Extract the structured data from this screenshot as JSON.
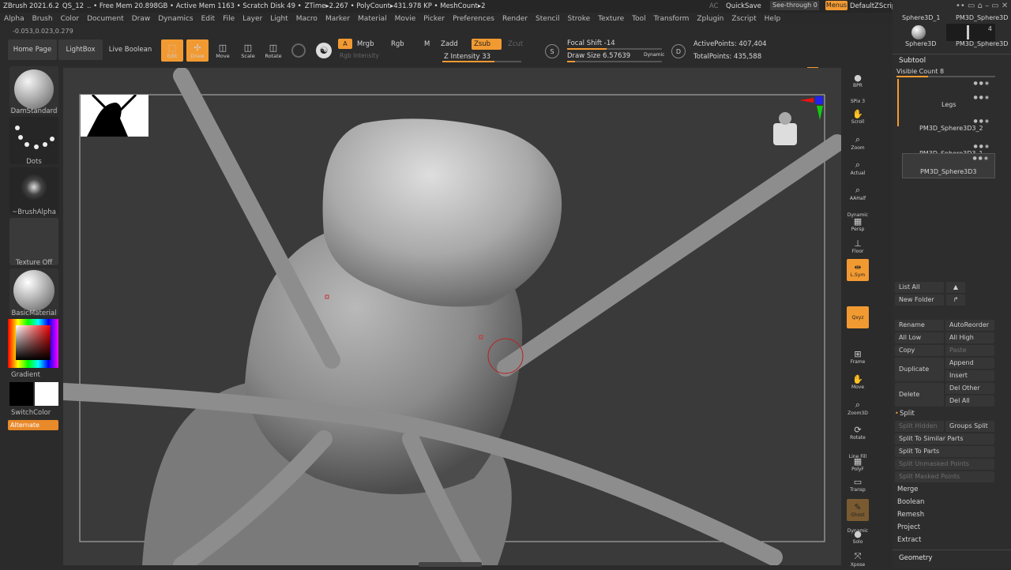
{
  "titlebar": {
    "items": [
      "ZBrush 2021.6.2",
      "QS_12",
      ".. • Free Mem 20.898GB • Active Mem 1163 • Scratch Disk 49 •",
      "ZTime▸2.267 • PolyCount▸431.978 KP • MeshCount▸2"
    ],
    "ac": "AC",
    "quicksave": "QuickSave",
    "seethrough": "See-through  0",
    "menus": "Menus",
    "script": "DefaultZScript"
  },
  "menubar": [
    "Alpha",
    "Brush",
    "Color",
    "Document",
    "Draw",
    "Dynamics",
    "Edit",
    "File",
    "Layer",
    "Light",
    "Macro",
    "Marker",
    "Material",
    "Movie",
    "Picker",
    "Preferences",
    "Render",
    "Stencil",
    "Stroke",
    "Texture",
    "Tool",
    "Transform",
    "Zplugin",
    "Zscript",
    "Help"
  ],
  "coords": "-0.053,0.023,0.279",
  "toolbar": {
    "home": "Home Page",
    "lightbox": "LightBox",
    "live_boolean": "Live Boolean",
    "edit": "Edit",
    "draw": "Draw",
    "move": "Move",
    "scale": "Scale",
    "rotate": "Rotate",
    "a": "A",
    "mrgb": "Mrgb",
    "rgb": "Rgb",
    "m": "M",
    "zadd": "Zadd",
    "zsub": "Zsub",
    "zcut": "Zcut",
    "rgb_intensity": "Rgb Intensity",
    "z_intensity": "Z Intensity 33",
    "focal_shift": "Focal Shift -14",
    "draw_size": "Draw Size 6.57639",
    "dynamic": "Dynamic",
    "active_points": "ActivePoints: 407,404",
    "total_points": "TotalPoints: 435,588",
    "s": "S",
    "d": "D"
  },
  "left": {
    "brush": "DamStandard",
    "stroke": "Dots",
    "alpha": "~BrushAlpha",
    "texture": "Texture Off",
    "material": "BasicMaterial",
    "gradient": "Gradient",
    "switchcolor": "SwitchColor",
    "alternate": "Alternate"
  },
  "rail": [
    "BPR",
    "SPix 3",
    "Scroll",
    "Zoom",
    "Actual",
    "AAHalf",
    "Dynamic",
    "Persp",
    "Floor",
    "L.Sym",
    "Qxyz",
    "Frame",
    "Move",
    "Zoom3D",
    "Rotate",
    "Line Fill",
    "PolyF",
    "Transp",
    "Ghost",
    "Dynamic",
    "Solo",
    "Xpose"
  ],
  "right": {
    "thumbs": [
      "Sphere3D_1",
      "PM3D_Sphere3D",
      "Sphere3D",
      "PM3D_Sphere3D"
    ],
    "thumb_count": "4",
    "subtool": "Subtool",
    "visible_count": "Visible Count 8",
    "items": [
      "Legs",
      "PM3D_Sphere3D3_2",
      "PM3D_Sphere3D3_1",
      "PM3D_Sphere3D3"
    ],
    "list_all": "List All",
    "new_folder": "New Folder",
    "rename": "Rename",
    "autoreorder": "AutoReorder",
    "all_low": "All Low",
    "all_high": "All High",
    "copy": "Copy",
    "paste": "Paste",
    "duplicate": "Duplicate",
    "append": "Append",
    "insert": "Insert",
    "delete": "Delete",
    "del_other": "Del Other",
    "del_all": "Del All",
    "split": "Split",
    "split_hidden": "Split Hidden",
    "groups_split": "Groups Split",
    "split_similar": "Split To Similar Parts",
    "split_parts": "Split To Parts",
    "split_unmasked": "Split Unmasked Points",
    "split_masked": "Split Masked Points",
    "merge": "Merge",
    "boolean": "Boolean",
    "remesh": "Remesh",
    "project": "Project",
    "extract": "Extract",
    "geometry": "Geometry"
  },
  "colors": {
    "accent": "#f29a32",
    "bg": "#2b2b2b",
    "viewport": "#3a3a3a"
  }
}
